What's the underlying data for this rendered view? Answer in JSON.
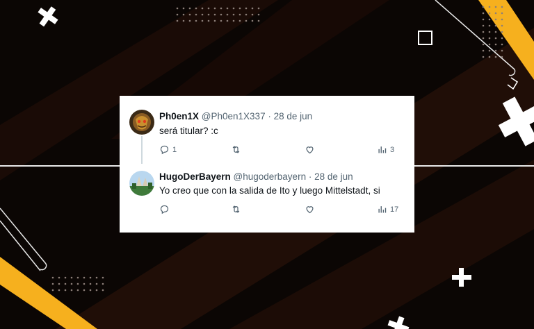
{
  "tweets": [
    {
      "name": "Ph0en1X",
      "handle": "@Ph0en1X337",
      "sep": "·",
      "date": "28 de jun",
      "text": "será titular? :c",
      "replies": "1",
      "retweets": "",
      "likes": "",
      "views": "3"
    },
    {
      "name": "HugoDerBayern",
      "handle": "@hugoderbayern",
      "sep": "·",
      "date": "28 de jun",
      "text": "Yo creo que con la salida de Ito y luego Mittelstadt, si",
      "replies": "",
      "retweets": "",
      "likes": "",
      "views": "17"
    }
  ],
  "colors": {
    "accent_yellow": "#f6b01e",
    "card_bg": "#ffffff",
    "muted_text": "#536471",
    "dark_bg": "#0b0604"
  }
}
